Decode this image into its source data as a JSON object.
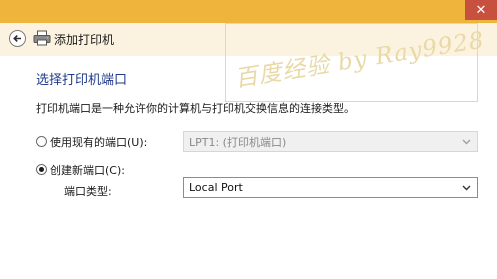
{
  "window": {
    "close_symbol": "✕"
  },
  "header": {
    "title": "添加打印机"
  },
  "watermark": {
    "text": "百度经验 by Ray9928"
  },
  "page": {
    "heading": "选择打印机端口",
    "description": "打印机端口是一种允许你的计算机与打印机交换信息的连接类型。"
  },
  "options": {
    "existing_port": {
      "label": "使用现有的端口(U):",
      "selected": false,
      "value": "LPT1: (打印机端口)"
    },
    "new_port": {
      "label": "创建新端口(C):",
      "selected": true,
      "type_label": "端口类型:",
      "type_value": "Local Port"
    }
  },
  "colors": {
    "titlebar": "#efb43b",
    "close": "#c7503e",
    "header_bg": "#fbf3df",
    "heading": "#1f3a8a"
  },
  "icons": [
    "back-arrow-icon",
    "printer-icon",
    "close-icon",
    "chevron-down-icon"
  ]
}
